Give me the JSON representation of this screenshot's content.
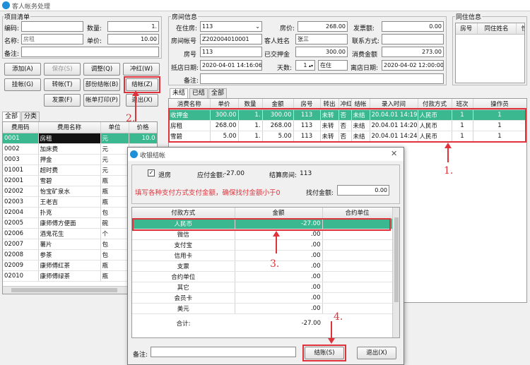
{
  "window": {
    "title": "客人帐务处理"
  },
  "items_panel": {
    "title": "项目清单",
    "code_label": "编码:",
    "code_value": "",
    "qty_label": "数量:",
    "qty_value": "1.",
    "name_label": "名称:",
    "name_value": "房租",
    "price_label": "单价:",
    "price_value": "10.00",
    "note_label": "备注:",
    "note_value": ""
  },
  "buttons": {
    "add": "添加(A)",
    "save": "保存(S)",
    "adjust": "调整(Q)",
    "reverse": "冲红(W)",
    "hang": "挂帐(G)",
    "transfer": "转帐(T)",
    "partial": "部份结帐(B)",
    "checkout": "结帐(Z)",
    "invoice": "发票(F)",
    "print": "帐单打印(P)",
    "exit": "退出(X)"
  },
  "catalog": {
    "tabs": [
      "全部",
      "分类"
    ],
    "headers": [
      "费用码",
      "费用名称",
      "单位",
      "价格"
    ],
    "rows": [
      [
        "0001",
        "房租",
        "元",
        "10.0"
      ],
      [
        "0002",
        "加床费",
        "元",
        ""
      ],
      [
        "0003",
        "押金",
        "元",
        ""
      ],
      [
        "01001",
        "超时费",
        "元",
        ""
      ],
      [
        "02001",
        "雪碧",
        "瓶",
        ""
      ],
      [
        "02002",
        "怡宝矿泉水",
        "瓶",
        ""
      ],
      [
        "02003",
        "王老吉",
        "瓶",
        ""
      ],
      [
        "02004",
        "扑克",
        "包",
        ""
      ],
      [
        "02005",
        "康师傅方便面",
        "碗",
        ""
      ],
      [
        "02006",
        "酒鬼花生",
        "个",
        ""
      ],
      [
        "02007",
        "薯片",
        "包",
        ""
      ],
      [
        "02008",
        "参茶",
        "包",
        ""
      ],
      [
        "02009",
        "康师傅红茶",
        "瓶",
        ""
      ],
      [
        "02010",
        "康师傅绿茶",
        "瓶",
        ""
      ]
    ]
  },
  "room_info": {
    "title": "房间信息",
    "in_room_label": "在住房:",
    "in_room_value": "113",
    "room_price_label": "房价:",
    "room_price_value": "268.00",
    "invoice_amt_label": "发票额:",
    "invoice_amt_value": "0.00",
    "account_label": "房间帐号",
    "account_value": "Z202004010001",
    "guest_label": "客人姓名",
    "guest_value": "张三",
    "contact_label": "联系方式:",
    "contact_value": "",
    "room_no_label": "房号",
    "room_no_value": "113",
    "deposit_label": "已交押金",
    "deposit_value": "300.00",
    "consume_label": "消费金额",
    "consume_value": "273.00",
    "arrive_label": "抵店日期:",
    "arrive_value": "2020-04-01 14:16:06",
    "days_label": "天数:",
    "days_value": "1",
    "status_value": "在住",
    "leave_label": "离店日期:",
    "leave_value": "2020-04-02 12:00:00",
    "note_label": "备注:",
    "note_value": ""
  },
  "co_guests": {
    "title": "同住信息",
    "headers": [
      "房号",
      "同住姓名",
      "性"
    ]
  },
  "bill": {
    "tabs": [
      "未结",
      "已结",
      "全部"
    ],
    "headers": [
      "消费名称",
      "单价",
      "数量",
      "金额",
      "房号",
      "转出",
      "冲红",
      "结帐",
      "录入时间",
      "付款方式",
      "班次",
      "操作员"
    ],
    "rows": [
      [
        "收押金",
        "300.00",
        "1.",
        "300.00",
        "113",
        "未转",
        "否",
        "未结",
        "20.04.01 14:19",
        "人民币",
        "1",
        "1"
      ],
      [
        "房租",
        "268.00",
        "1.",
        "268.00",
        "113",
        "未转",
        "否",
        "未结",
        "20.04.01 14:20",
        "人民币",
        "1",
        "1"
      ],
      [
        "雪碧",
        "5.00",
        "1.",
        "5.00",
        "113",
        "未转",
        "否",
        "未结",
        "20.04.01 14:24",
        "人民币",
        "1",
        "1"
      ]
    ]
  },
  "dialog": {
    "title": "收银结帐",
    "checkout_room_label": "退房",
    "receivable_label": "应付金额:",
    "receivable_value": "-27.00",
    "settle_room_label": "结算房间:",
    "settle_room_value": "113",
    "hint": "填写各种支付方式支付金额，确保找付金额小于0",
    "change_label": "找付金额:",
    "change_value": "0.00",
    "headers": [
      "付款方式",
      "金额",
      "合约单位"
    ],
    "payments": [
      [
        "人民币",
        "-27.00",
        ""
      ],
      [
        "微信",
        ".00",
        ""
      ],
      [
        "支付宝",
        ".00",
        ""
      ],
      [
        "信用卡",
        ".00",
        ""
      ],
      [
        "支票",
        ".00",
        ""
      ],
      [
        "合约单位",
        ".00",
        ""
      ],
      [
        "其它",
        ".00",
        ""
      ],
      [
        "会员卡",
        ".00",
        ""
      ],
      [
        "美元",
        ".00",
        ""
      ]
    ],
    "total_label": "合计:",
    "total_value": "-27.00",
    "note_label": "备注:",
    "note_value": "",
    "confirm_button": "结账(S)",
    "exit_button": "退出(X)"
  },
  "annotations": [
    "1.",
    "2.",
    "3.",
    "4."
  ],
  "colors": {
    "selected_row": "#3cb890",
    "annotation": "#e0323b",
    "app_icon": "#1f8fd8"
  }
}
